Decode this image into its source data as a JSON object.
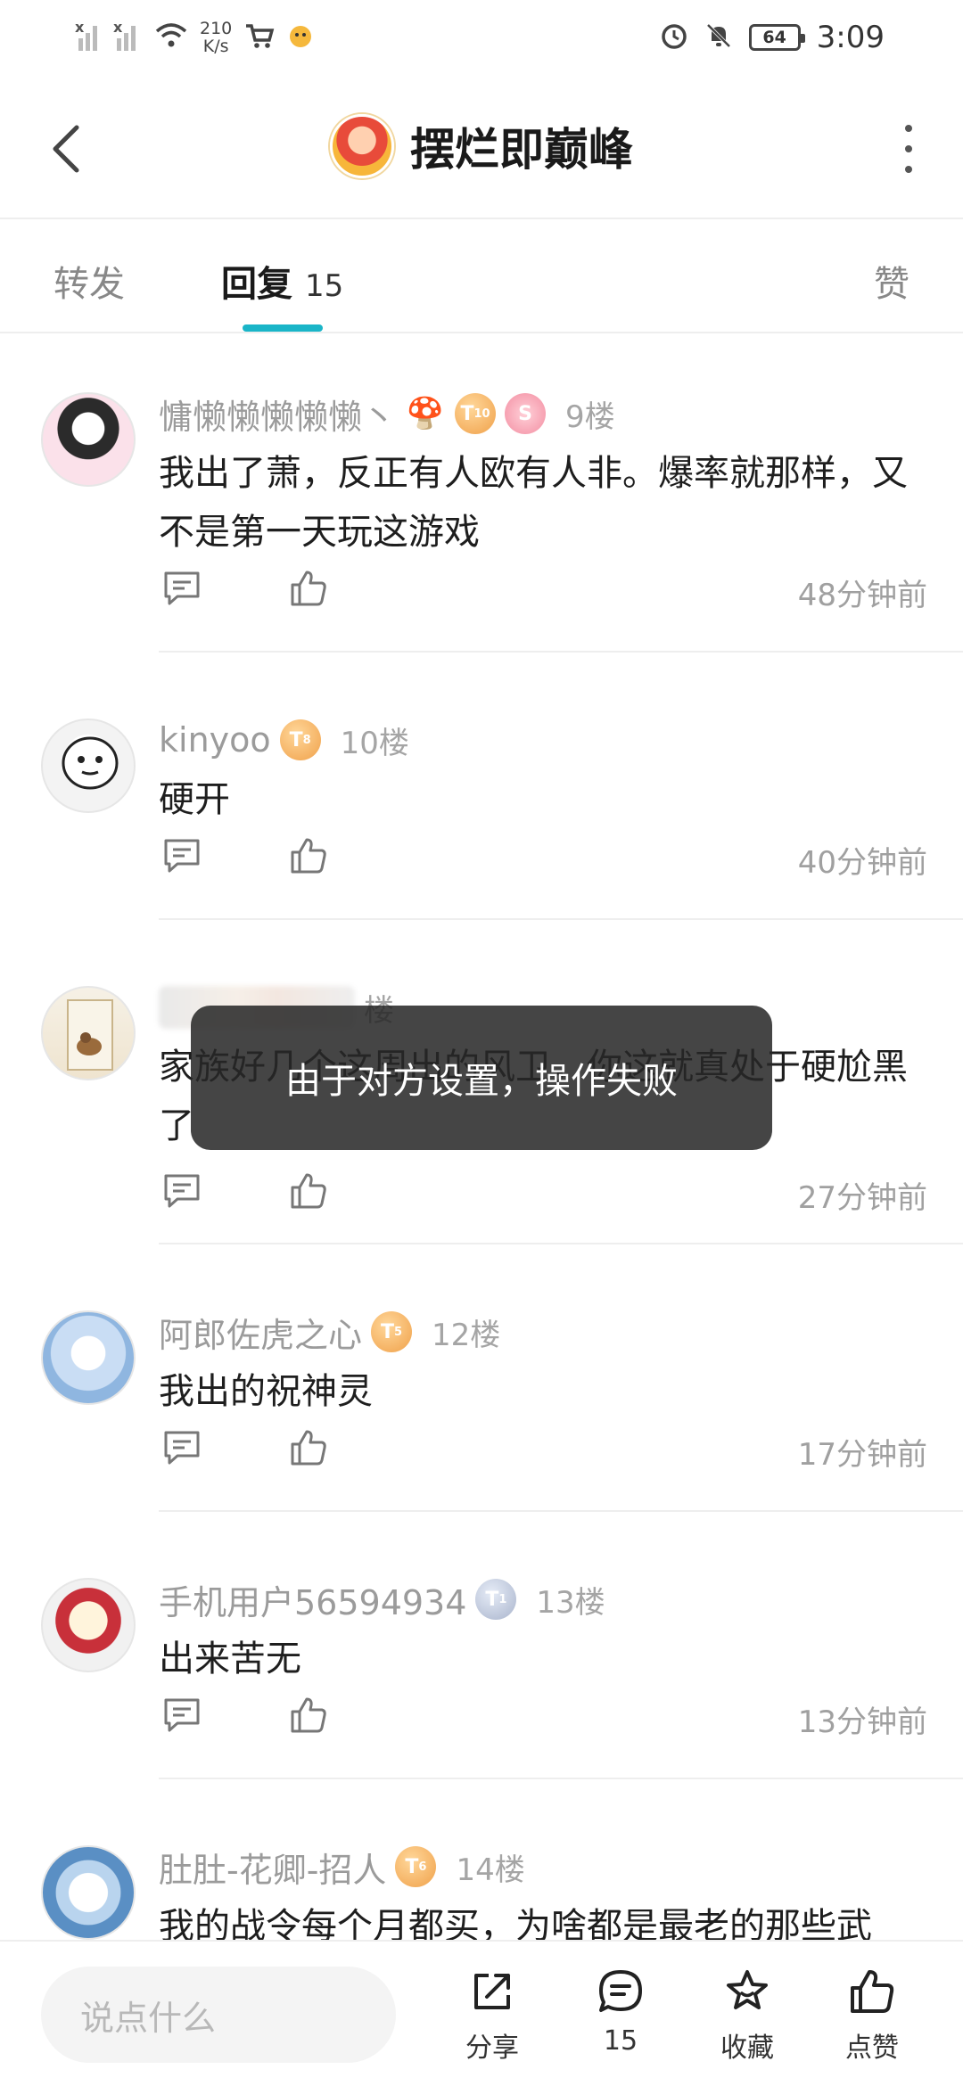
{
  "status_bar": {
    "speed_value": "210",
    "speed_unit": "K/s",
    "battery": "64",
    "time": "3:09"
  },
  "header": {
    "title": "摆烂即巅峰"
  },
  "tabs": {
    "forward": "转发",
    "reply": "回复",
    "reply_count": "15",
    "like": "赞"
  },
  "comments": [
    {
      "username": "慵懒懒懒懒懒丶",
      "badge_level": "10",
      "floor": "9楼",
      "text": "我出了萧，反正有人欧有人非。爆率就那样，又不是第一天玩这游戏",
      "time": "48分钟前"
    },
    {
      "username": "kinyoo",
      "badge_level": "8",
      "floor": "10楼",
      "text": "硬开",
      "time": "40分钟前"
    },
    {
      "username": "",
      "floor": "楼",
      "text": "家族好几个这周出的风卫，你这就真处于硬尬黑了",
      "time": "27分钟前"
    },
    {
      "username": "阿郎佐虎之心",
      "badge_level": "5",
      "floor": "12楼",
      "text": "我出的祝神灵",
      "time": "17分钟前"
    },
    {
      "username": "手机用户56594934",
      "badge_level": "1",
      "floor": "13楼",
      "text": "出来苦无",
      "time": "13分钟前"
    },
    {
      "username": "肚肚-花卿-招人",
      "badge_level": "6",
      "floor": "14楼",
      "text": "我的战令每个月都买，为啥都是最老的那些武"
    }
  ],
  "toast": {
    "message": "由于对方设置，操作失败"
  },
  "bottom_bar": {
    "input_placeholder": "说点什么",
    "share_label": "分享",
    "reply_count": "15",
    "favorite_label": "收藏",
    "like_label": "点赞"
  },
  "colors": {
    "accent": "#1ab5c8",
    "badge_gold": "#f0a14a",
    "muted_text": "#9b9b9b"
  }
}
